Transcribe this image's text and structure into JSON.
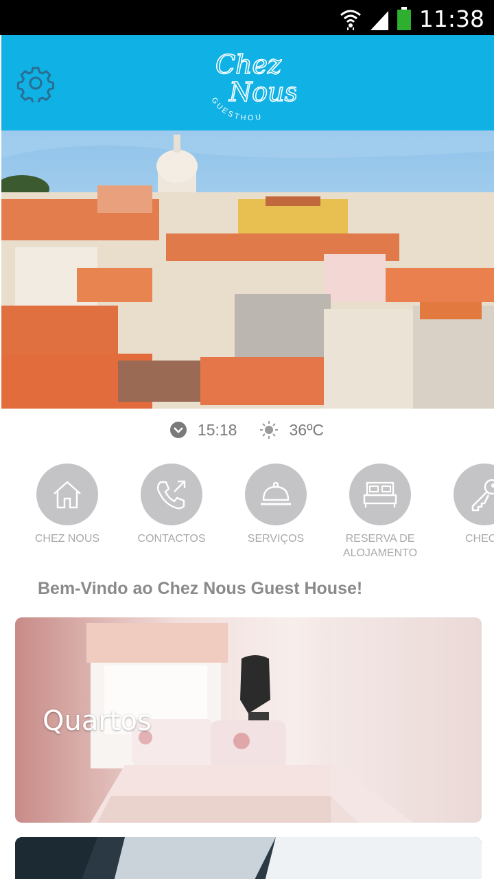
{
  "status_bar": {
    "time": "11:38",
    "icons": [
      "wifi-icon",
      "signal-icon",
      "battery-icon"
    ]
  },
  "header": {
    "logo_text_top": "Chez",
    "logo_text_bottom": "Nous",
    "logo_subtitle": "GUESTHOUSE",
    "background_color": "#10b1e4"
  },
  "info": {
    "time": "15:18",
    "temperature": "36ºC",
    "time_icon": "clock-icon",
    "weather_icon": "sun-icon"
  },
  "quick_nav": [
    {
      "label": "CHEZ NOUS",
      "icon": "home-icon"
    },
    {
      "label": "CONTACTOS",
      "icon": "phone-icon"
    },
    {
      "label": "SERVIÇOS",
      "icon": "service-bell-icon"
    },
    {
      "label": "RESERVA DE\nALOJAMENTO",
      "icon": "bed-icon"
    },
    {
      "label": "CHECK",
      "icon": "key-icon"
    }
  ],
  "welcome": "Bem-Vindo ao Chez Nous Guest House!",
  "cards": [
    {
      "title": "Quartos"
    }
  ]
}
